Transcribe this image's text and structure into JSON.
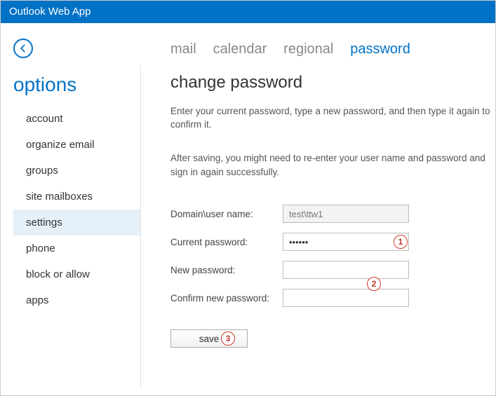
{
  "titlebar": {
    "title": "Outlook Web App"
  },
  "sidebar": {
    "heading": "options",
    "items": [
      {
        "label": "account",
        "selected": false
      },
      {
        "label": "organize email",
        "selected": false
      },
      {
        "label": "groups",
        "selected": false
      },
      {
        "label": "site mailboxes",
        "selected": false
      },
      {
        "label": "settings",
        "selected": true
      },
      {
        "label": "phone",
        "selected": false
      },
      {
        "label": "block or allow",
        "selected": false
      },
      {
        "label": "apps",
        "selected": false
      }
    ]
  },
  "tabs": [
    {
      "label": "mail",
      "active": false
    },
    {
      "label": "calendar",
      "active": false
    },
    {
      "label": "regional",
      "active": false
    },
    {
      "label": "password",
      "active": true
    }
  ],
  "page": {
    "heading": "change password",
    "instruction1": "Enter your current password, type a new password, and then type it again to confirm it.",
    "instruction2": "After saving, you might need to re-enter your user name and password and sign in again successfully."
  },
  "form": {
    "domain_label": "Domain\\user name:",
    "domain_value": "test\\ttw1",
    "current_label": "Current password:",
    "current_value": "••••••",
    "new_label": "New password:",
    "new_value": "",
    "confirm_label": "Confirm new password:",
    "confirm_value": "",
    "save_label": "save"
  },
  "callouts": {
    "c1": "1",
    "c2": "2",
    "c3": "3"
  }
}
